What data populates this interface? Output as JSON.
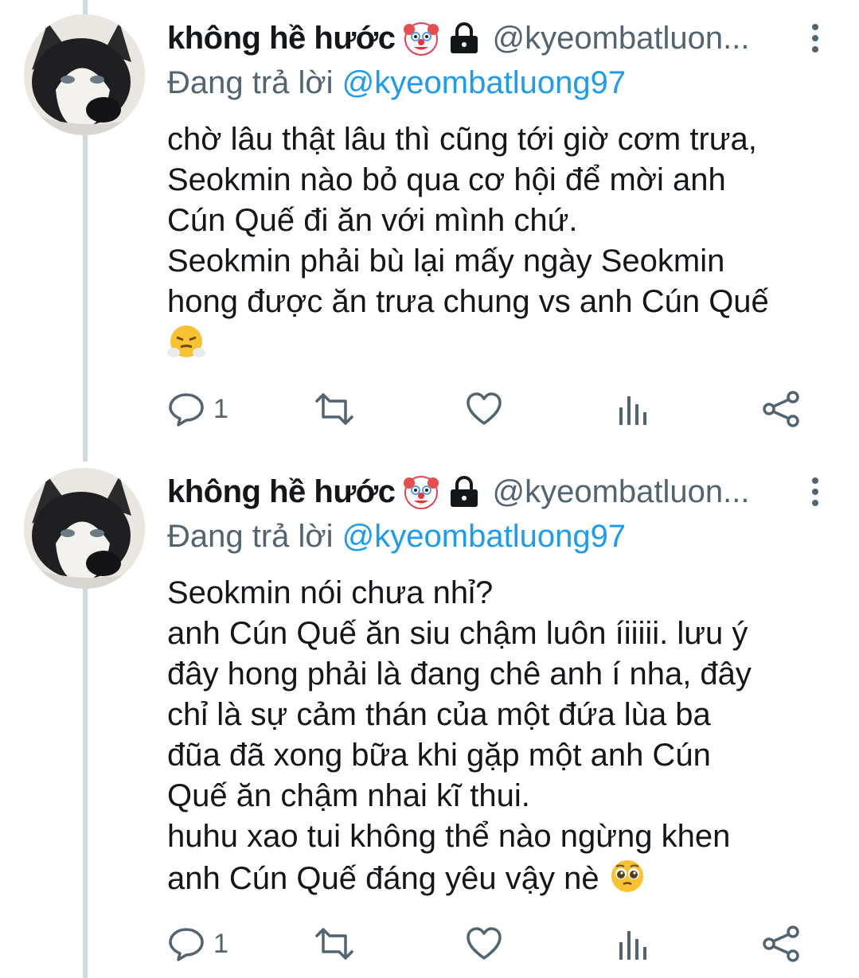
{
  "tweets": [
    {
      "display_name": "không hề hước",
      "handle": "@kyeombatluon...",
      "reply_prefix": "Đang trả lời",
      "reply_mention": "@kyeombatluong97",
      "body": "chờ lâu thật lâu thì cũng tới giờ cơm trưa,\nSeokmin nào bỏ qua cơ hội để mời anh\nCún Quế đi ăn với mình chứ.\nSeokmin phải bù lại mấy ngày Seokmin\nhong được ăn trưa chung vs anh Cún Quế",
      "end_emoji": "face-with-steam-from-nose",
      "reply_count": "1",
      "name_emoji": "clown-face-icon",
      "lock_icon": "lock-icon"
    },
    {
      "display_name": "không hề hước",
      "handle": "@kyeombatluon...",
      "reply_prefix": "Đang trả lời",
      "reply_mention": "@kyeombatluong97",
      "body": "Seokmin nói chưa nhỉ?\nanh Cún Quế ăn siu chậm luôn íiiiii. lưu ý\nđây hong phải là đang chê anh í nha, đây\nchỉ là sự cảm thán của một đứa lùa ba\nđũa đã xong bữa khi gặp một anh Cún\nQuế ăn chậm nhai kĩ thui.\nhuhu xao tui không thể nào ngừng khen\nanh Cún Quế đáng yêu vậy nè",
      "end_emoji": "pleading-face",
      "reply_count": "1",
      "name_emoji": "clown-face-icon",
      "lock_icon": "lock-icon"
    }
  ],
  "icons": {
    "reply": "reply-icon",
    "retweet": "retweet-icon",
    "like": "heart-icon",
    "analytics": "analytics-icon",
    "share": "share-icon",
    "more": "more-vertical-icon"
  },
  "colors": {
    "text": "#14171a",
    "secondary": "#536471",
    "link": "#1d9bf0",
    "thread": "#cfd9de"
  }
}
